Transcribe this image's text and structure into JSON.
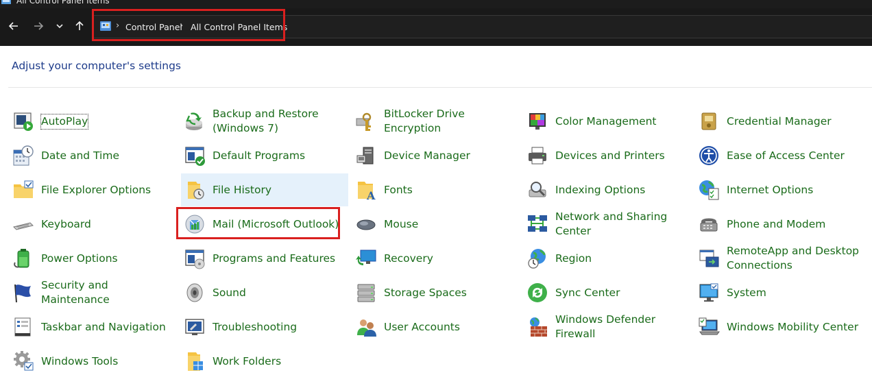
{
  "window": {
    "title": "All Control Panel Items"
  },
  "navigation": {
    "back": "back-arrow-icon",
    "forward": "forward-arrow-icon",
    "recent": "chevron-down-icon",
    "up": "up-arrow-icon"
  },
  "breadcrumb": {
    "items": [
      "Control Panel",
      "All Control Panel Items"
    ],
    "separator": "›"
  },
  "heading": "Adjust your computer's settings",
  "items": [
    {
      "label": "AutoPlay",
      "icon": "autoplay-icon"
    },
    {
      "label": "Backup and Restore (Windows 7)",
      "icon": "backup-restore-icon"
    },
    {
      "label": "BitLocker Drive Encryption",
      "icon": "bitlocker-icon"
    },
    {
      "label": "Color Management",
      "icon": "color-management-icon"
    },
    {
      "label": "Credential Manager",
      "icon": "credential-manager-icon"
    },
    {
      "label": "Date and Time",
      "icon": "date-time-icon"
    },
    {
      "label": "Default Programs",
      "icon": "default-programs-icon"
    },
    {
      "label": "Device Manager",
      "icon": "device-manager-icon"
    },
    {
      "label": "Devices and Printers",
      "icon": "printer-icon"
    },
    {
      "label": "Ease of Access Center",
      "icon": "ease-of-access-icon"
    },
    {
      "label": "File Explorer Options",
      "icon": "folder-options-icon"
    },
    {
      "label": "File History",
      "icon": "file-history-icon"
    },
    {
      "label": "Fonts",
      "icon": "fonts-icon"
    },
    {
      "label": "Indexing Options",
      "icon": "indexing-icon"
    },
    {
      "label": "Internet Options",
      "icon": "internet-options-icon"
    },
    {
      "label": "Keyboard",
      "icon": "keyboard-icon"
    },
    {
      "label": "Mail (Microsoft Outlook)",
      "icon": "mail-icon"
    },
    {
      "label": "Mouse",
      "icon": "mouse-icon"
    },
    {
      "label": "Network and Sharing Center",
      "icon": "network-icon"
    },
    {
      "label": "Phone and Modem",
      "icon": "phone-modem-icon"
    },
    {
      "label": "Power Options",
      "icon": "power-options-icon"
    },
    {
      "label": "Programs and Features",
      "icon": "programs-features-icon"
    },
    {
      "label": "Recovery",
      "icon": "recovery-icon"
    },
    {
      "label": "Region",
      "icon": "region-icon"
    },
    {
      "label": "RemoteApp and Desktop Connections",
      "icon": "remoteapp-icon"
    },
    {
      "label": "Security and Maintenance",
      "icon": "security-flag-icon"
    },
    {
      "label": "Sound",
      "icon": "speaker-icon"
    },
    {
      "label": "Storage Spaces",
      "icon": "storage-spaces-icon"
    },
    {
      "label": "Sync Center",
      "icon": "sync-center-icon"
    },
    {
      "label": "System",
      "icon": "system-monitor-icon"
    },
    {
      "label": "Taskbar and Navigation",
      "icon": "taskbar-icon"
    },
    {
      "label": "Troubleshooting",
      "icon": "troubleshooting-icon"
    },
    {
      "label": "User Accounts",
      "icon": "user-accounts-icon"
    },
    {
      "label": "Windows Defender Firewall",
      "icon": "firewall-icon"
    },
    {
      "label": "Windows Mobility Center",
      "icon": "mobility-center-icon"
    },
    {
      "label": "Windows Tools",
      "icon": "windows-tools-icon"
    },
    {
      "label": "Work Folders",
      "icon": "work-folders-icon"
    }
  ],
  "colors": {
    "link_text": "#1a6b1a",
    "heading": "#1d3b8a",
    "highlight_box": "#d9201f",
    "hover_background": "#e5f1fb",
    "navbar_background": "#191919"
  }
}
